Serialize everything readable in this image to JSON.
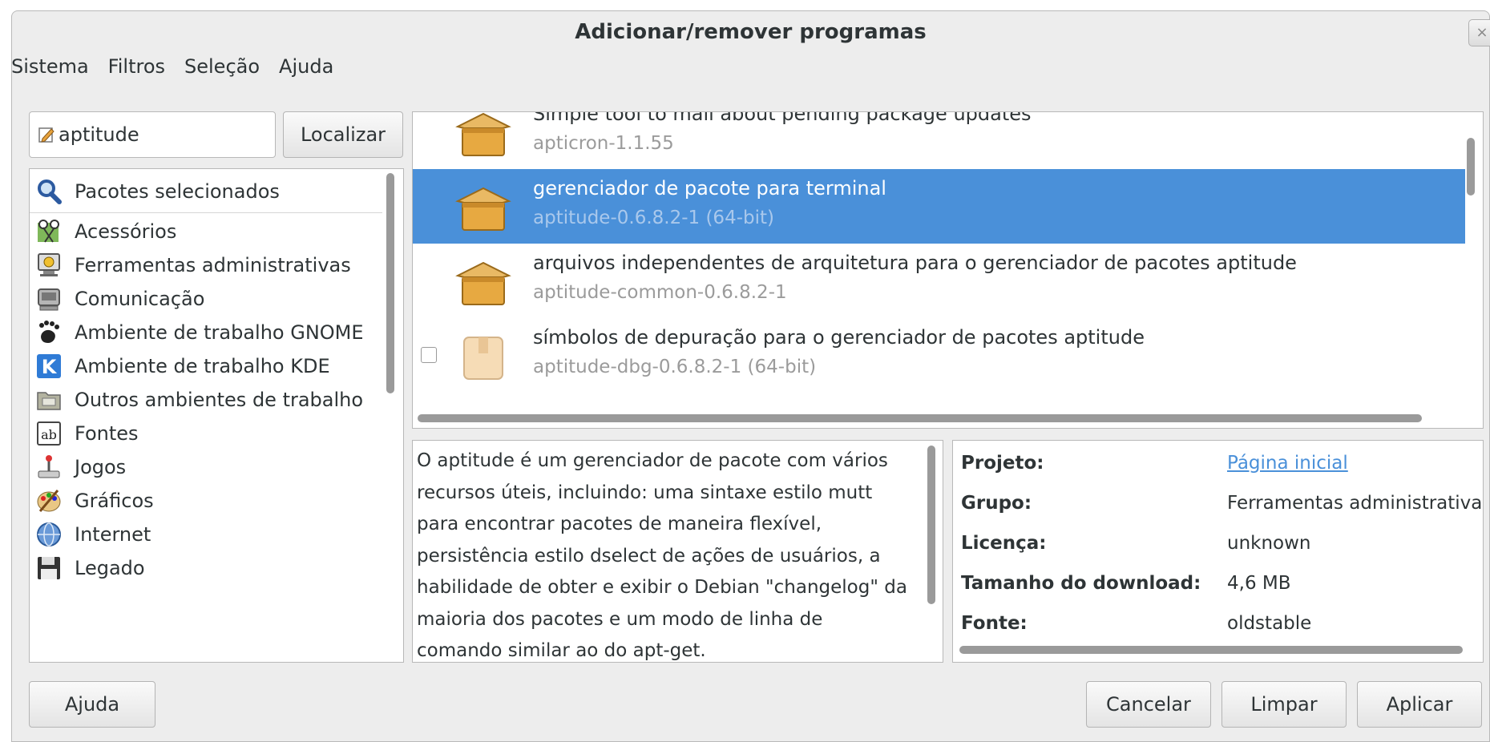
{
  "window": {
    "title": "Adicionar/remover programas",
    "close_glyph": "×"
  },
  "menu": [
    "Sistema",
    "Filtros",
    "Seleção",
    "Ajuda"
  ],
  "search": {
    "value": "aptitude",
    "button": "Localizar",
    "icon": "edit-icon"
  },
  "categories": [
    {
      "label": "Pacotes selecionados",
      "icon": "magnifier-icon"
    },
    {
      "label": "Acessórios",
      "icon": "accessories-icon"
    },
    {
      "label": "Ferramentas administrativas",
      "icon": "admin-tools-icon"
    },
    {
      "label": "Comunicação",
      "icon": "communication-icon"
    },
    {
      "label": "Ambiente de trabalho GNOME",
      "icon": "gnome-foot-icon"
    },
    {
      "label": "Ambiente de trabalho KDE",
      "icon": "kde-icon"
    },
    {
      "label": "Outros ambientes de trabalho",
      "icon": "folder-icon"
    },
    {
      "label": "Fontes",
      "icon": "fonts-icon"
    },
    {
      "label": "Jogos",
      "icon": "joystick-icon"
    },
    {
      "label": "Gráficos",
      "icon": "palette-icon"
    },
    {
      "label": "Internet",
      "icon": "globe-icon"
    },
    {
      "label": "Legado",
      "icon": "floppy-icon"
    }
  ],
  "packages": [
    {
      "title": "Simple tool to mail about pending package updates",
      "subtitle": "apticron-1.1.55",
      "installed": true,
      "selected": false
    },
    {
      "title": "gerenciador de pacote para terminal",
      "subtitle": "aptitude-0.6.8.2-1 (64-bit)",
      "installed": true,
      "selected": true
    },
    {
      "title": "arquivos independentes de arquitetura para o gerenciador de pacotes aptitude",
      "subtitle": "aptitude-common-0.6.8.2-1",
      "installed": true,
      "selected": false
    },
    {
      "title": "símbolos de depuração para o gerenciador de pacotes aptitude",
      "subtitle": "aptitude-dbg-0.6.8.2-1 (64-bit)",
      "installed": false,
      "selected": false
    }
  ],
  "description": "O aptitude é um gerenciador de pacote com vários recursos úteis, incluindo: uma sintaxe estilo mutt para encontrar pacotes de maneira flexível, persistência estilo dselect de ações de usuários, a habilidade de obter e exibir o Debian \"changelog\" da maioria dos pacotes e um modo de linha de comando similar ao do apt-get.",
  "details": [
    {
      "label": "Projeto:",
      "value": "Página inicial",
      "link": true
    },
    {
      "label": "Grupo:",
      "value": "Ferramentas administrativas",
      "link": false
    },
    {
      "label": "Licença:",
      "value": "unknown",
      "link": false
    },
    {
      "label": "Tamanho do download:",
      "value": "4,6 MB",
      "link": false
    },
    {
      "label": "Fonte:",
      "value": "oldstable",
      "link": false
    }
  ],
  "buttons": {
    "help": "Ajuda",
    "cancel": "Cancelar",
    "clear": "Limpar",
    "apply": "Aplicar"
  },
  "colors": {
    "selection": "#4a90d9",
    "link": "#4a90d9",
    "window_bg": "#ededed"
  }
}
